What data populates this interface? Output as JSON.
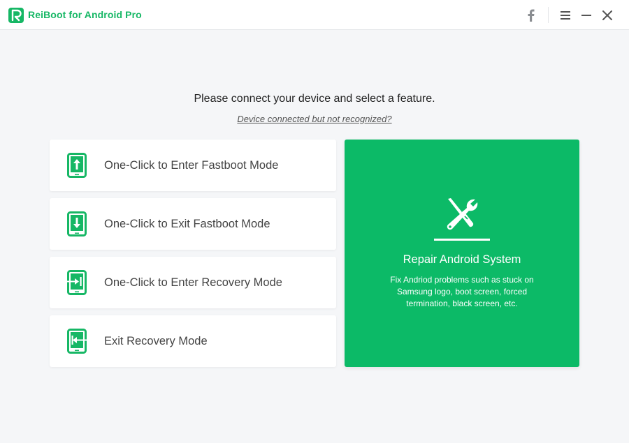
{
  "app": {
    "title": "ReiBoot for Android Pro",
    "brand_color": "#0cba67"
  },
  "titlebar": {
    "icons": [
      "facebook-icon",
      "menu-icon",
      "minimize-icon",
      "close-icon"
    ]
  },
  "main": {
    "prompt": "Please connect your device and select a feature.",
    "help_link": "Device connected but not recognized?"
  },
  "options": [
    {
      "label": "One-Click to Enter Fastboot Mode",
      "icon": "phone-arrow-up-icon"
    },
    {
      "label": "One-Click to Exit Fastboot Mode",
      "icon": "phone-arrow-down-icon"
    },
    {
      "label": "One-Click to Enter Recovery Mode",
      "icon": "phone-arrow-in-icon"
    },
    {
      "label": "Exit Recovery Mode",
      "icon": "phone-arrow-out-icon"
    }
  ],
  "repair": {
    "title": "Repair Android System",
    "description": "Fix Andriod problems such as stuck on Samsung logo, boot screen, forced termination, black screen, etc.",
    "icon": "wrench-screwdriver-icon"
  }
}
